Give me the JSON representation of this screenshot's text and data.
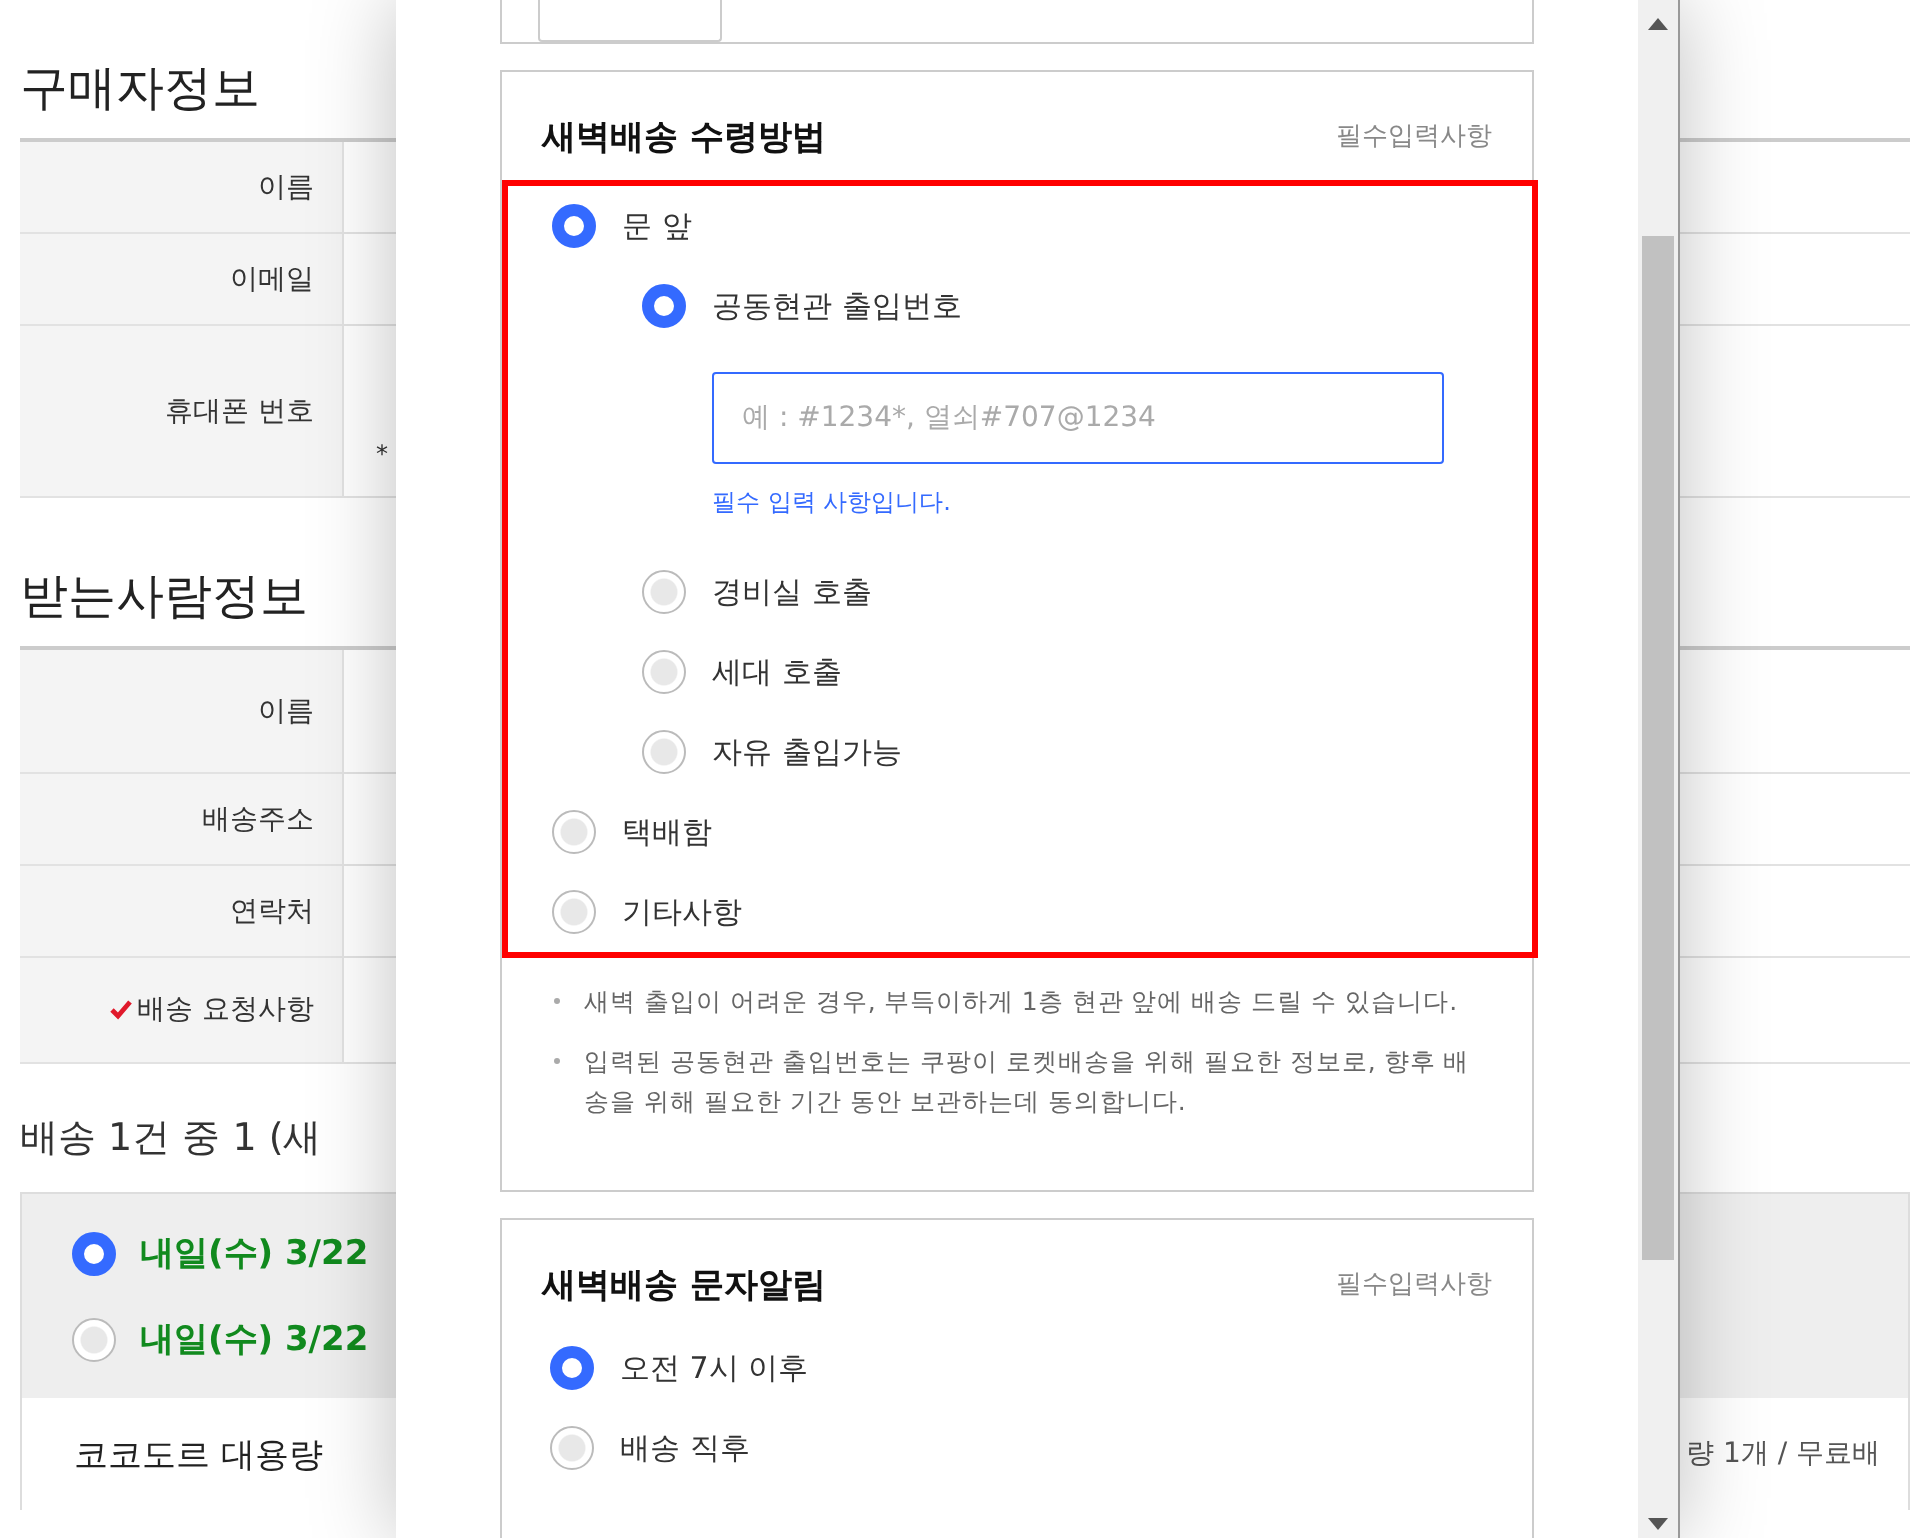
{
  "background_page": {
    "buyer_section": {
      "title": "구매자정보",
      "rows": [
        {
          "label": "이름"
        },
        {
          "label": "이메일"
        },
        {
          "label": "휴대폰 번호",
          "note": "*"
        }
      ]
    },
    "recipient_section": {
      "title": "받는사람정보",
      "rows": [
        {
          "label": "이름",
          "required": false
        },
        {
          "label": "배송주소",
          "required": false
        },
        {
          "label": "연락처",
          "required": false
        },
        {
          "label": "배송 요청사항",
          "required": true
        }
      ]
    },
    "shipment": {
      "title": "배송 1건 중 1 (새",
      "options": [
        {
          "label": "내일(수) 3/22",
          "selected": true
        },
        {
          "label": "내일(수) 3/22",
          "selected": false
        }
      ],
      "item": "코코도르 대용량",
      "item_detail": "량 1개 / 무료배"
    }
  },
  "modal": {
    "method_card": {
      "title": "새벽배송 수령방법",
      "required_note": "필수입력사항",
      "highlighted": true,
      "options": [
        {
          "label": "문 앞",
          "selected": true,
          "children": [
            {
              "label": "공동현관 출입번호",
              "selected": true,
              "field": {
                "placeholder": "예 : #1234*, 열쇠#707@1234"
              },
              "error": "필수 입력 사항입니다."
            },
            {
              "label": "경비실 호출",
              "selected": false
            },
            {
              "label": "세대 호출",
              "selected": false
            },
            {
              "label": "자유 출입가능",
              "selected": false
            }
          ]
        },
        {
          "label": "택배함",
          "selected": false
        },
        {
          "label": "기타사항",
          "selected": false
        }
      ],
      "notes": [
        "새벽 출입이 어려운 경우, 부득이하게 1층 현관 앞에 배송 드릴 수 있습니다.",
        "입력된 공동현관 출입번호는 쿠팡이 로켓배송을 위해 필요한 정보로, 향후 배송을 위해 필요한 기간 동안 보관하는데 동의합니다."
      ]
    },
    "sms_card": {
      "title": "새벽배송 문자알림",
      "required_note": "필수입력사항",
      "options": [
        {
          "label": "오전 7시 이후",
          "selected": true
        },
        {
          "label": "배송 직후",
          "selected": false
        }
      ]
    }
  }
}
